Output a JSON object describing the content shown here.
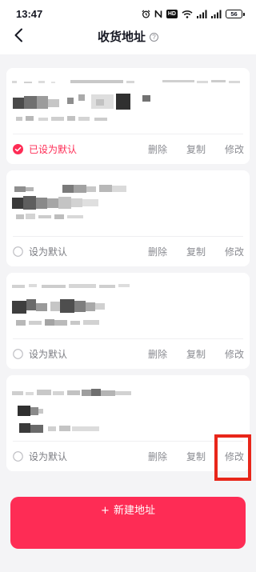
{
  "status_bar": {
    "time": "13:47",
    "icons": [
      "alarm-icon",
      "nfc-icon",
      "hd-icon",
      "wifi-icon",
      "signal-icon",
      "signal-icon",
      "battery-icon"
    ],
    "hd_label": "HD",
    "battery_level": "56"
  },
  "header": {
    "back_icon": "chevron-left-icon",
    "title": "收货地址",
    "help_icon": "question-circle-icon",
    "help_glyph": "?"
  },
  "addresses": [
    {
      "is_default": true,
      "default_label": "已设为默认",
      "actions": {
        "delete": "删除",
        "copy": "复制",
        "edit": "修改"
      }
    },
    {
      "is_default": false,
      "default_label": "设为默认",
      "actions": {
        "delete": "删除",
        "copy": "复制",
        "edit": "修改"
      }
    },
    {
      "is_default": false,
      "default_label": "设为默认",
      "actions": {
        "delete": "删除",
        "copy": "复制",
        "edit": "修改"
      }
    },
    {
      "is_default": false,
      "default_label": "设为默认",
      "actions": {
        "delete": "删除",
        "copy": "复制",
        "edit": "修改"
      }
    }
  ],
  "new_address_button": {
    "icon": "+",
    "label": "新建地址"
  },
  "colors": {
    "accent": "#fe2c55",
    "annotation_box": "#e8261a",
    "page_background": "#f4f4f6",
    "card_background": "#ffffff",
    "muted_text": "#8a8b91"
  }
}
